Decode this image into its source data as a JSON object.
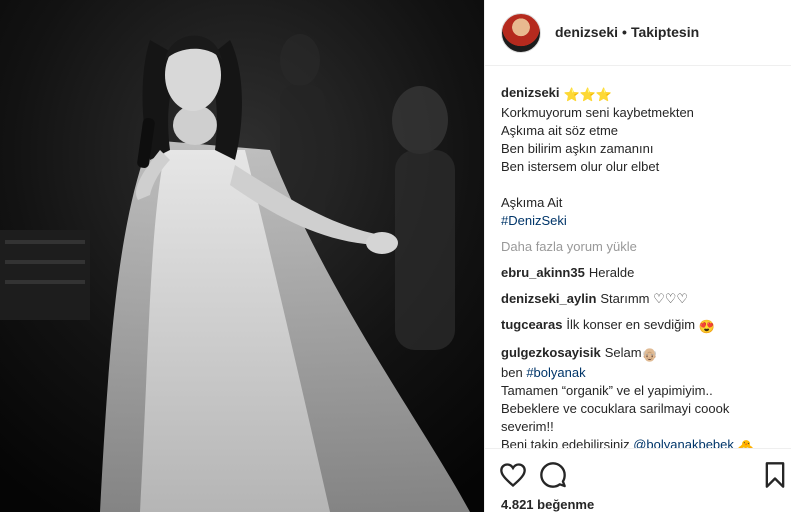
{
  "post": {
    "image_alt": "Concert photo of singer on stage",
    "header": {
      "username": "denizseki",
      "separator": "•",
      "follow_status": "Takiptesin"
    },
    "caption": {
      "username": "denizseki",
      "stars": "⭐⭐⭐",
      "lines": [
        "Korkmuyorum seni kaybetmekten",
        "Aşkıma ait söz etme",
        "Ben bilirim aşkın zamanını",
        "Ben istersem olur olur elbet",
        "",
        "Aşkıma Ait"
      ],
      "hashtag": "#DenizSeki"
    },
    "load_more": "Daha fazla yorum yükle",
    "comments": [
      {
        "username": "ebru_akinn35",
        "text": "Heralde"
      },
      {
        "username": "denizseki_aylin",
        "text": "Starımm ♡♡♡"
      },
      {
        "username": "tugcearas",
        "text": "İlk konser en sevdiğim",
        "emoji": "😍"
      },
      {
        "username": "gulgezkosayisik",
        "text": "Selam",
        "emoji": "👴🏼"
      }
    ],
    "promo": {
      "line1_prefix": "ben ",
      "line1_tag": "#bolyanak",
      "line2": "Tamamen “organik” ve el yapimiyim..",
      "line3": "Bebeklere ve cocuklara sarilmayi coook",
      "line4": "severim!!",
      "line5_prefix": "Beni takip edebilirsiniz ",
      "line5_tag": "@bolyanakbebek",
      "line5_emoji": "🐣",
      "line6_emoji": "💕🎁"
    },
    "likes": "4.821 beğenme",
    "icons": [
      "heart-icon",
      "comment-icon",
      "bookmark-icon"
    ]
  }
}
